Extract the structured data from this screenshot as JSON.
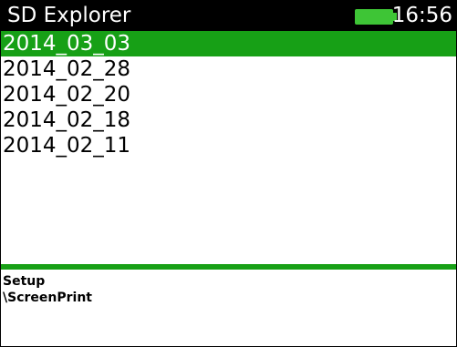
{
  "window": {
    "title": "SD Explorer",
    "time": "16:56",
    "battery_icon": "battery-full-icon",
    "battery_level": 1.0
  },
  "files": [
    {
      "name": "2014_03_03",
      "selected": true
    },
    {
      "name": "2014_02_28",
      "selected": false
    },
    {
      "name": "2014_02_20",
      "selected": false
    },
    {
      "name": "2014_02_18",
      "selected": false
    },
    {
      "name": "2014_02_11",
      "selected": false
    }
  ],
  "status": {
    "line1": "Setup",
    "line2": "\\ScreenPrint"
  },
  "colors": {
    "title_bar": "#000000",
    "selection": "#17a016",
    "battery": "#3ec536",
    "divider": "#17a016"
  }
}
